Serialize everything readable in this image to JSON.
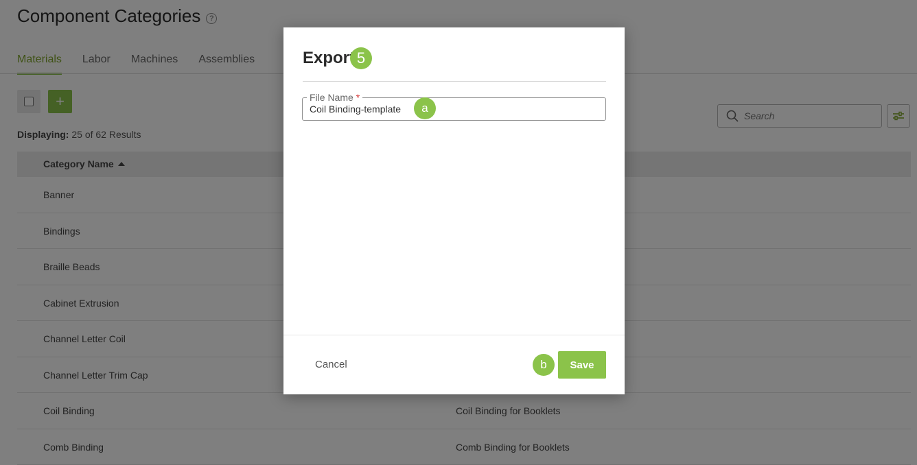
{
  "page": {
    "title": "Component Categories",
    "help_icon": "?"
  },
  "tabs": [
    {
      "label": "Materials",
      "active": true
    },
    {
      "label": "Labor",
      "active": false
    },
    {
      "label": "Machines",
      "active": false
    },
    {
      "label": "Assemblies",
      "active": false
    }
  ],
  "toolbar": {
    "add_label": "+",
    "displaying_label": "Displaying:",
    "displaying_value": "25 of 62 Results",
    "search_placeholder": "Search"
  },
  "table": {
    "column_name": "Category Name",
    "rows": [
      {
        "name": "Banner",
        "description": ""
      },
      {
        "name": "Bindings",
        "description": ""
      },
      {
        "name": "Braille Beads",
        "description": ""
      },
      {
        "name": "Cabinet Extrusion",
        "description": ""
      },
      {
        "name": "Channel Letter Coil",
        "description": ""
      },
      {
        "name": "Channel Letter Trim Cap",
        "description": ""
      },
      {
        "name": "Coil Binding",
        "description": "Coil Binding for Booklets"
      },
      {
        "name": "Comb Binding",
        "description": "Comb Binding for Booklets"
      }
    ]
  },
  "modal": {
    "title": "Export",
    "step_badge": "5",
    "field_label": "File Name",
    "required_mark": "*",
    "field_value": "Coil Binding-template",
    "badge_a": "a",
    "badge_b": "b",
    "cancel_label": "Cancel",
    "save_label": "Save"
  },
  "colors": {
    "accent": "#8bc34a",
    "overlay": "rgba(0,0,0,0.5)"
  }
}
